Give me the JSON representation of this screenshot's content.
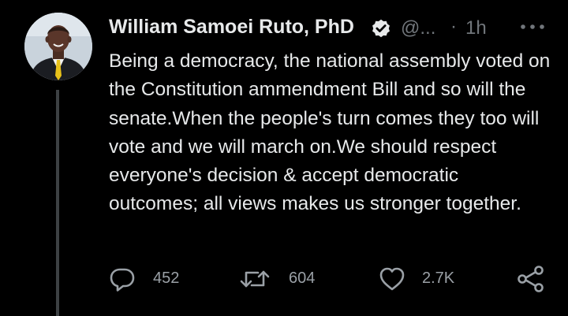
{
  "tweet": {
    "author": {
      "display_name": "William Samoei Ruto, PhD",
      "handle": "@...",
      "avatar_icon": "profile-photo",
      "verified_icon": "verified-badge-icon"
    },
    "separator": "·",
    "time": "1h",
    "text": "Being a democracy, the national assembly voted on the Constitution ammendment Bill and so will the senate.When the people's turn comes they too will vote and we will march on.We should respect everyone's decision & accept democratic outcomes; all views makes us stronger together.",
    "actions": {
      "reply": {
        "icon": "reply-icon",
        "count": "452"
      },
      "retweet": {
        "icon": "retweet-icon",
        "count": "604"
      },
      "like": {
        "icon": "heart-icon",
        "count": "2.7K"
      },
      "share": {
        "icon": "share-icon"
      },
      "more": {
        "icon": "more-icon"
      }
    }
  },
  "colors": {
    "background": "#000000",
    "primary_text": "#e7e9ea",
    "secondary_text": "#71767b",
    "thread_line": "#3d4144"
  }
}
